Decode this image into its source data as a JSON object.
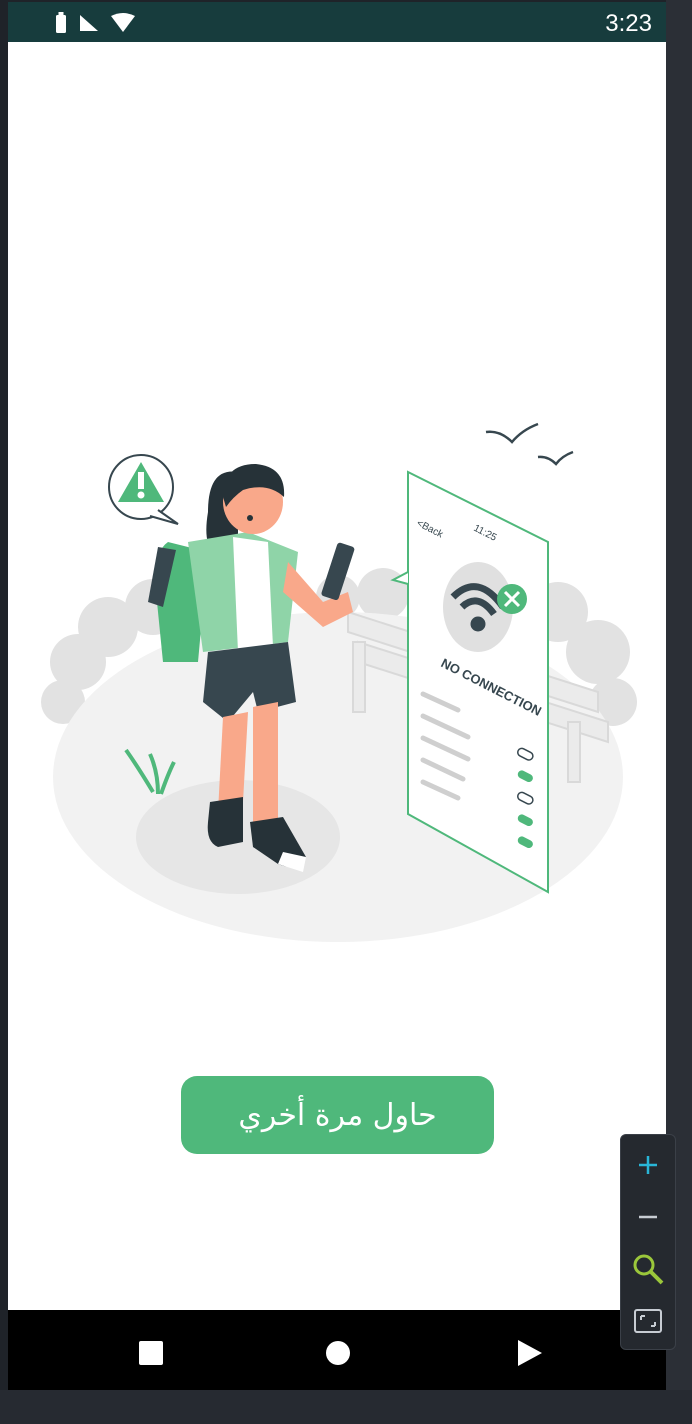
{
  "status_bar": {
    "time": "3:23",
    "icons": [
      "battery-icon",
      "signal-icon",
      "wifi-icon"
    ]
  },
  "illustration": {
    "phone_time": "11:25",
    "phone_back": "<Back",
    "phone_message": "NO CONNECTION",
    "colors": {
      "accent": "#4fb87b",
      "dark": "#37474f",
      "skin": "#f9a88a"
    }
  },
  "retry_button": {
    "label": "حاول مرة أخري"
  },
  "nav_bar": {
    "icons": [
      "recent-apps-icon",
      "home-icon",
      "back-icon"
    ]
  },
  "zoom_controls": {
    "icons": [
      "zoom-in-icon",
      "zoom-out-icon",
      "zoom-reset-icon",
      "fit-screen-icon"
    ]
  },
  "colors": {
    "status_bar": "#173c3d",
    "button": "#4fb87b",
    "nav_bar": "#000000"
  }
}
